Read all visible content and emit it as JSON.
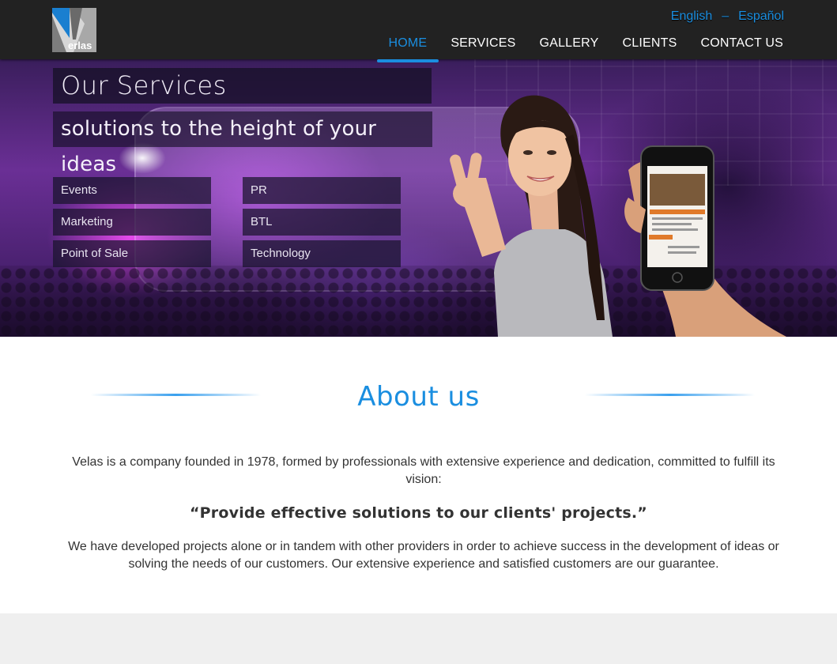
{
  "header": {
    "logo_text": "erlas",
    "languages": [
      "English",
      "Español"
    ],
    "language_separator": "–",
    "nav": [
      {
        "label": "HOME",
        "active": true
      },
      {
        "label": "SERVICES",
        "active": false
      },
      {
        "label": "GALLERY",
        "active": false
      },
      {
        "label": "CLIENTS",
        "active": false
      },
      {
        "label": "CONTACT US",
        "active": false
      }
    ]
  },
  "hero": {
    "title": "Our Services",
    "subtitle": "solutions to the height of your ideas",
    "services_left": [
      "Events",
      "Marketing",
      "Point of Sale"
    ],
    "services_right": [
      "PR",
      "BTL",
      "Technology"
    ]
  },
  "about": {
    "title": "About us",
    "paragraph1": "Velas is a company founded in 1978, formed by professionals with extensive experience and dedication, committed to fulfill its vision:",
    "quote": "“Provide effective solutions to our clients' projects.”",
    "paragraph2": "We have developed projects alone or in tandem with other providers in order to achieve success in the development of ideas or solving the needs of our customers. Our extensive experience and satisfied customers are our guarantee."
  },
  "colors": {
    "accent": "#1a8ee0",
    "header_bg": "#222222",
    "footer_bg": "#efefef"
  }
}
